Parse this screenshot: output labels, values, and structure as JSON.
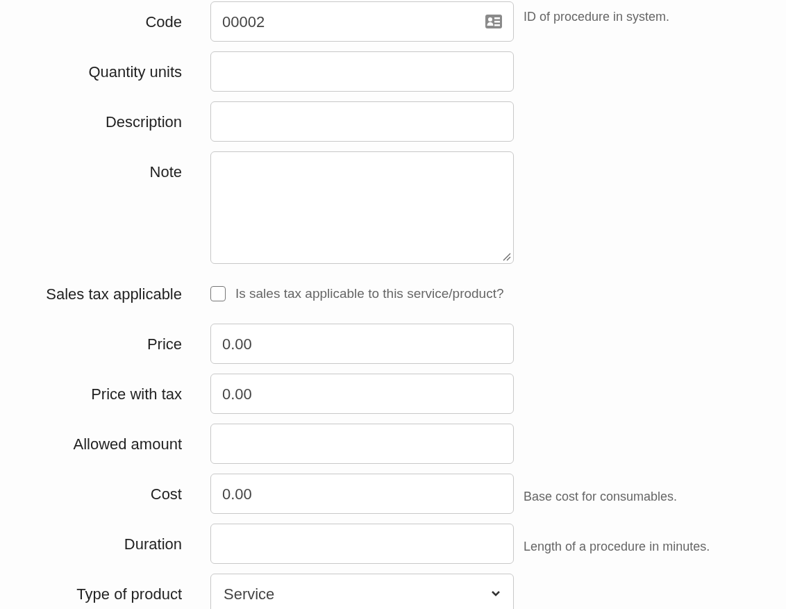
{
  "form": {
    "rows": [
      {
        "kind": "text",
        "label": "Code",
        "value": "00002",
        "icon": true,
        "help": "ID of procedure in system."
      },
      {
        "kind": "text",
        "label": "Quantity units"
      },
      {
        "kind": "text",
        "label": "Description"
      },
      {
        "kind": "textarea",
        "label": "Note"
      },
      {
        "kind": "checkbox",
        "label": "Sales tax applicable",
        "checked": false,
        "help": "Is sales tax applicable to this service/product?"
      },
      {
        "kind": "text",
        "label": "Price",
        "value": "0.00"
      },
      {
        "kind": "text",
        "label": "Price with tax",
        "value": "0.00"
      },
      {
        "kind": "text",
        "label": "Allowed amount"
      },
      {
        "kind": "text",
        "label": "Cost",
        "value": "0.00",
        "help": "Base cost for consumables."
      },
      {
        "kind": "text",
        "label": "Duration",
        "help": "Length of a procedure in minutes."
      },
      {
        "kind": "select",
        "label": "Type of product",
        "value": "Service"
      }
    ]
  }
}
